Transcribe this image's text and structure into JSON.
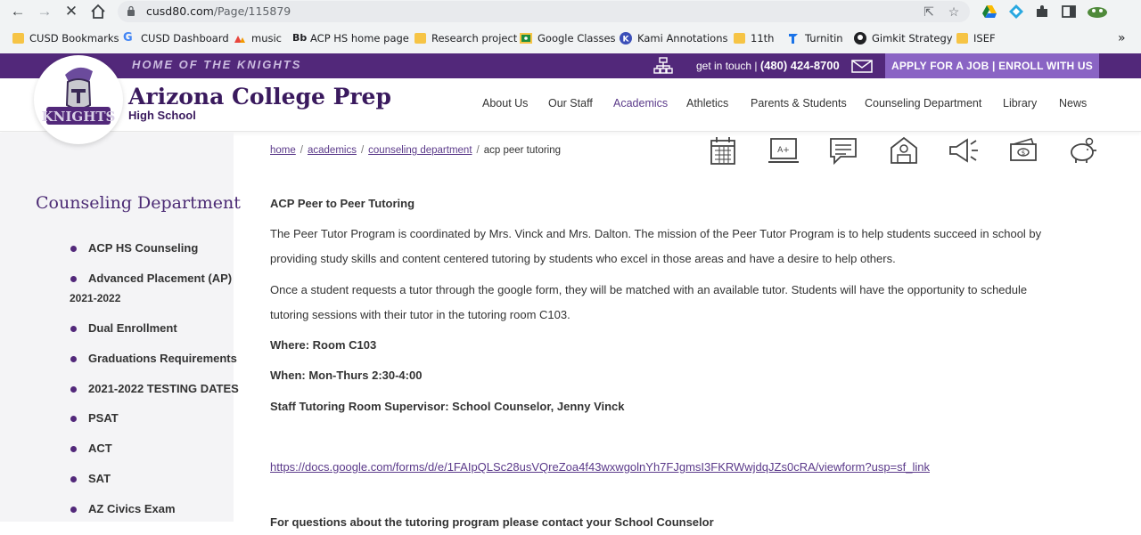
{
  "browser": {
    "url_domain": "cusd80.com",
    "url_path": "/Page/115879",
    "bookmarks": [
      {
        "label": "CUSD Bookmarks",
        "icon": "folder-icon"
      },
      {
        "label": "CUSD Dashboard",
        "icon": "google-g-icon"
      },
      {
        "label": "music",
        "icon": "music-icon"
      },
      {
        "label": "ACP HS home page",
        "icon": "bb-icon"
      },
      {
        "label": "Research project",
        "icon": "folder-icon"
      },
      {
        "label": "Google Classes",
        "icon": "classroom-icon"
      },
      {
        "label": "Kami Annotations",
        "icon": "kami-icon"
      },
      {
        "label": "11th",
        "icon": "folder-icon"
      },
      {
        "label": "Turnitin",
        "icon": "turnitin-icon"
      },
      {
        "label": "Gimkit Strategy",
        "icon": "github-icon"
      },
      {
        "label": "ISEF",
        "icon": "folder-icon"
      }
    ],
    "more_bookmarks": "»"
  },
  "site": {
    "motto": "HOME OF THE KNIGHTS",
    "get_in_touch": "get in touch",
    "phone": "(480) 424-8700",
    "apply_text": "APPLY FOR A JOB  |  ENROLL WITH US",
    "school_name": "Arizona College Prep",
    "school_sub": "High School",
    "nav": [
      "About Us",
      "Our Staff",
      "Academics",
      "Athletics",
      "Parents & Students",
      "Counseling Department",
      "Library",
      "News"
    ],
    "accent_color": "#52287a"
  },
  "breadcrumb": {
    "items": [
      "home",
      "academics",
      "counseling department"
    ],
    "current": "acp peer tutoring"
  },
  "quick_icons": [
    "calendar-icon",
    "grades-icon",
    "chat-icon",
    "school-icon",
    "megaphone-icon",
    "payment-icon",
    "piggy-bank-icon"
  ],
  "sidebar": {
    "title": "Counseling Department",
    "items": [
      {
        "label": "ACP HS Counseling",
        "label2": ""
      },
      {
        "label": "Advanced Placement (AP)",
        "label2": "2021-2022"
      },
      {
        "label": "Dual Enrollment",
        "label2": ""
      },
      {
        "label": "Graduations Requirements",
        "label2": ""
      },
      {
        "label": "2021-2022 TESTING DATES",
        "label2": ""
      },
      {
        "label": "PSAT",
        "label2": ""
      },
      {
        "label": "ACT",
        "label2": ""
      },
      {
        "label": "SAT",
        "label2": ""
      },
      {
        "label": "AZ Civics Exam",
        "label2": ""
      }
    ]
  },
  "content": {
    "heading": "ACP Peer to Peer Tutoring",
    "para1_line1": "The Peer Tutor Program is coordinated by Mrs. Vinck and Mrs. Dalton. The mission of the Peer Tutor Program is to help students succeed in school by",
    "para1_line2": "providing study skills and content centered tutoring by students who excel in those areas and have a desire to help others.",
    "para2_line1": "Once a student requests a tutor through the google form, they will be matched with an available tutor. Students will have the opportunity to schedule",
    "para2_line2": "tutoring sessions with their tutor in the tutoring room C103.",
    "where": "Where: Room C103",
    "when": "When: Mon-Thurs 2:30-4:00",
    "supervisor": "Staff Tutoring Room Supervisor: School Counselor, Jenny Vinck",
    "form_link": "https://docs.google.com/forms/d/e/1FAIpQLSc28usVQreZoa4f43wxwgolnYh7FJgmsI3FKRWwjdqJZs0cRA/viewform?usp=sf_link",
    "questions": "For questions about the tutoring program please contact your School Counselor"
  }
}
